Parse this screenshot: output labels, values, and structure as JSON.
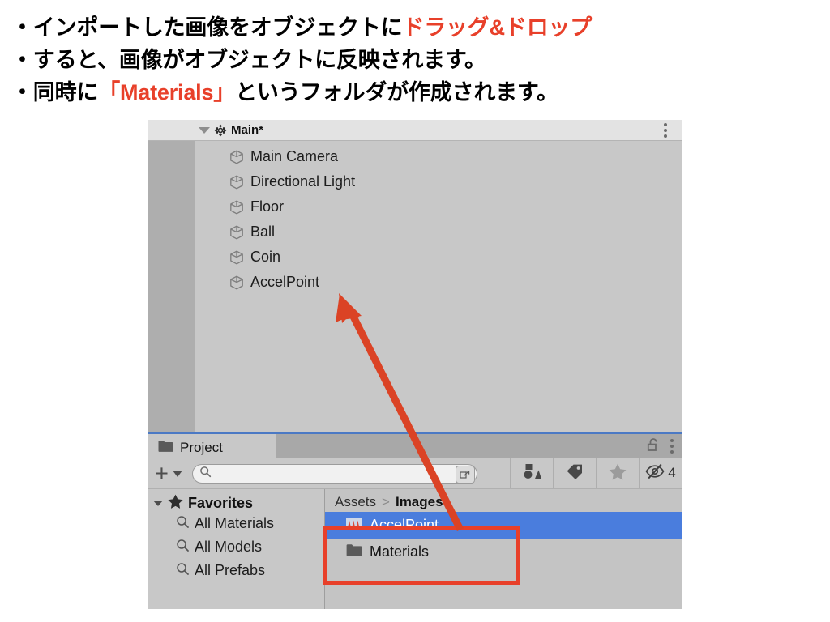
{
  "bullets": [
    {
      "prefix": "・インポートした画像をオブジェクトに",
      "highlight": "ドラッグ&ドロップ",
      "suffix": ""
    },
    {
      "prefix": "・すると、画像がオブジェクトに反映されます。",
      "highlight": "",
      "suffix": ""
    },
    {
      "prefix": "・同時に",
      "highlight": "「Materials」",
      "suffix": "というフォルダが作成されます。"
    }
  ],
  "colors": {
    "highlight": "#E8402A",
    "annotation": "#E8402A",
    "selection": "#4a7ddd",
    "tab_accent": "#4b79c4"
  },
  "hierarchy": {
    "scene_name": "Main*",
    "scene_icon": "unity-logo-icon",
    "expander": "triangle-down-icon",
    "menu_icon": "kebab-menu-icon",
    "items": [
      {
        "label": "Main Camera",
        "icon": "gameobject-cube-icon"
      },
      {
        "label": "Directional Light",
        "icon": "gameobject-cube-icon"
      },
      {
        "label": "Floor",
        "icon": "gameobject-cube-icon"
      },
      {
        "label": "Ball",
        "icon": "gameobject-cube-icon"
      },
      {
        "label": "Coin",
        "icon": "gameobject-cube-icon"
      },
      {
        "label": "AccelPoint",
        "icon": "gameobject-cube-icon"
      }
    ]
  },
  "project": {
    "tab_label": "Project",
    "tab_icon": "folder-icon",
    "lock_icon": "lock-open-icon",
    "menu_icon": "kebab-menu-icon",
    "toolbar": {
      "add_label": "+",
      "add_dropdown_icon": "chevron-down-icon",
      "search_value": "",
      "search_placeholder": "",
      "search_icon": "search-icon",
      "search_expand_icon": "expand-search-icon",
      "filters": [
        {
          "name": "filter-by-type",
          "icon": "shapes-icon",
          "count": ""
        },
        {
          "name": "filter-by-label",
          "icon": "tag-icon",
          "count": ""
        },
        {
          "name": "filter-favorites",
          "icon": "star-icon",
          "count": ""
        },
        {
          "name": "filter-hidden",
          "icon": "eye-off-icon",
          "count": "4"
        }
      ]
    },
    "favorites": {
      "label": "Favorites",
      "icon": "star-icon",
      "expander": "triangle-down-icon",
      "items": [
        {
          "label": "All Materials",
          "icon": "search-icon"
        },
        {
          "label": "All Models",
          "icon": "search-icon"
        },
        {
          "label": "All Prefabs",
          "icon": "search-icon"
        }
      ]
    },
    "breadcrumb": {
      "root": "Assets",
      "separator": ">",
      "current": "Images"
    },
    "assets": [
      {
        "label": "AccelPoint",
        "icon": "texture-asset-icon",
        "selected": true
      },
      {
        "label": "Materials",
        "icon": "folder-icon",
        "selected": false
      }
    ]
  },
  "annotation": {
    "box_label": "red-highlight-box",
    "arrow_label": "drag-drop-arrow"
  }
}
